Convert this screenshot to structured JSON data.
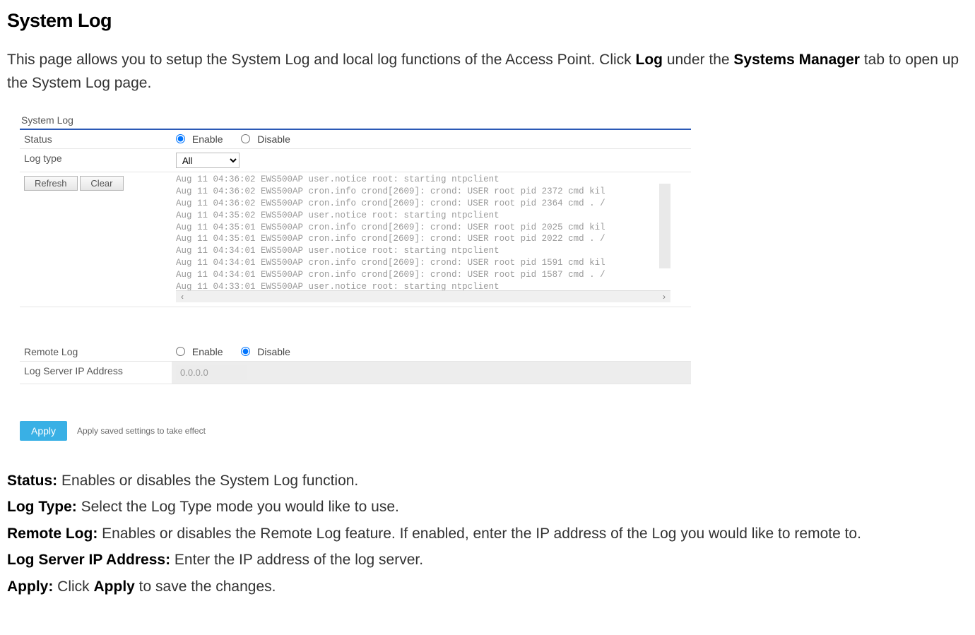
{
  "title": "System Log",
  "intro": {
    "text_before_log": "This page allows you to setup the System Log and local log functions of the Access Point. Click ",
    "bold_log": "Log",
    "text_mid": " under the ",
    "bold_sys_mgr": "Systems Manager",
    "text_after": " tab to open up the System Log page."
  },
  "panel": {
    "section_title": "System Log",
    "status": {
      "label": "Status",
      "enable": "Enable",
      "disable": "Disable",
      "selected": "enable"
    },
    "logtype": {
      "label": "Log type",
      "value": "All"
    },
    "buttons": {
      "refresh": "Refresh",
      "clear": "Clear"
    },
    "log_lines": [
      "Aug 11 04:36:02 EWS500AP user.notice root: starting ntpclient",
      "Aug 11 04:36:02 EWS500AP cron.info crond[2609]: crond: USER root pid 2372 cmd kil",
      "Aug 11 04:36:02 EWS500AP cron.info crond[2609]: crond: USER root pid 2364 cmd . /",
      "Aug 11 04:35:02 EWS500AP user.notice root: starting ntpclient",
      "Aug 11 04:35:01 EWS500AP cron.info crond[2609]: crond: USER root pid 2025 cmd kil",
      "Aug 11 04:35:01 EWS500AP cron.info crond[2609]: crond: USER root pid 2022 cmd . /",
      "Aug 11 04:34:01 EWS500AP user.notice root: starting ntpclient",
      "Aug 11 04:34:01 EWS500AP cron.info crond[2609]: crond: USER root pid 1591 cmd kil",
      "Aug 11 04:34:01 EWS500AP cron.info crond[2609]: crond: USER root pid 1587 cmd . /",
      "Aug 11 04:33:01 EWS500AP user.notice root: starting ntpclient"
    ],
    "remote": {
      "label": "Remote Log",
      "enable": "Enable",
      "disable": "Disable",
      "selected": "disable"
    },
    "server_ip": {
      "label": "Log Server IP Address",
      "value": "0.0.0.0"
    },
    "apply": {
      "button": "Apply",
      "note": "Apply saved settings to take effect"
    }
  },
  "defs": {
    "status_label": "Status:",
    "status_text": " Enables or disables the System Log function.",
    "logtype_label": "Log Type:",
    "logtype_text": " Select the Log Type mode you would like to use.",
    "remote_label": "Remote Log:",
    "remote_text": " Enables or disables the Remote Log feature. If enabled, enter the IP address of the Log you would like to remote to.",
    "ip_label": "Log Server IP Address:",
    "ip_text": " Enter the IP address of the log server.",
    "apply_label": "Apply:",
    "apply_pre": " Click ",
    "apply_bold": "Apply",
    "apply_post": " to save the changes."
  }
}
